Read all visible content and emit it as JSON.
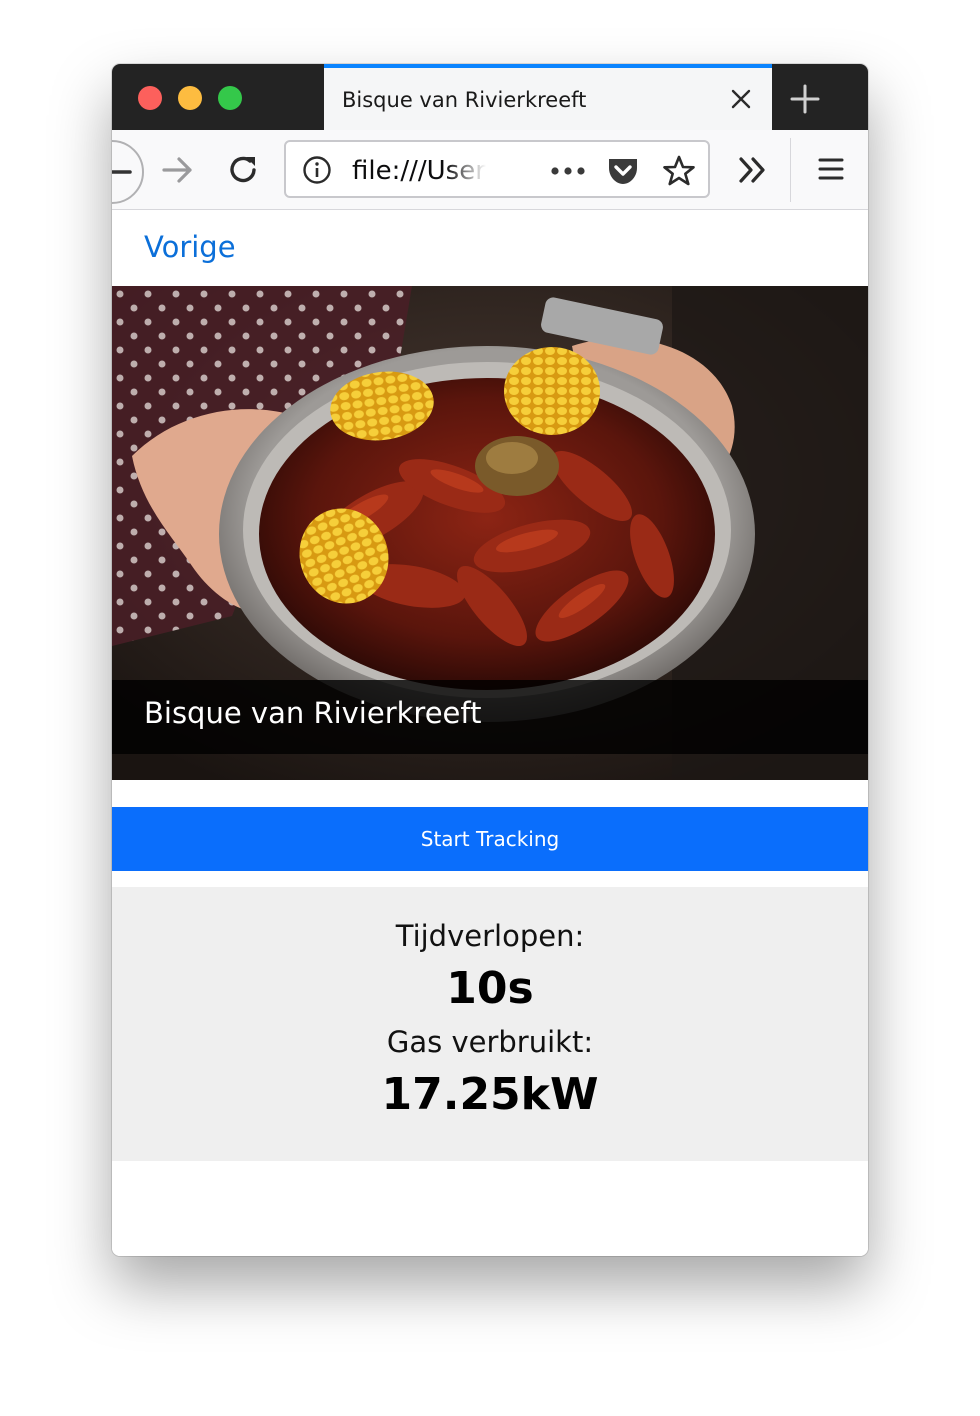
{
  "browser": {
    "tab_title": "Bisque van Rivierkreeft",
    "url": "file:///Users"
  },
  "page": {
    "back_link": "Vorige",
    "hero_caption": "Bisque van Rivierkreeft",
    "start_button": "Start Tracking",
    "stats": {
      "elapsed_label": "Tijdverlopen:",
      "elapsed_value": "10s",
      "gas_label": "Gas verbruikt:",
      "gas_value": "17.25kW"
    }
  },
  "colors": {
    "tab_accent": "#0a84ff",
    "link": "#0b6fd9",
    "button": "#0a6efc",
    "stats_background": "#efefef"
  },
  "icons": [
    "back-arrow-icon",
    "forward-arrow-icon",
    "reload-icon",
    "info-icon",
    "more-actions-icon",
    "pocket-icon",
    "bookmark-star-icon",
    "overflow-chevron-icon",
    "hamburger-menu-icon",
    "tab-close-icon",
    "new-tab-icon"
  ]
}
